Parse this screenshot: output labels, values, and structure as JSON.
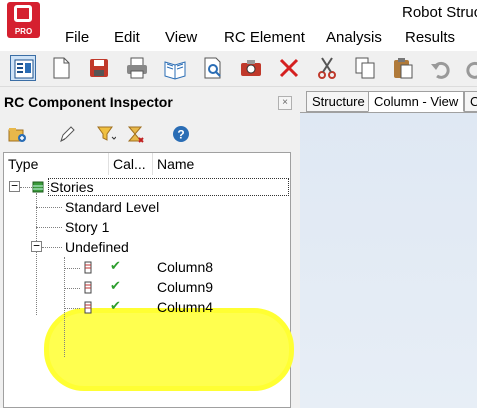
{
  "app": {
    "title": "Robot Struc",
    "logo_text": "PRO",
    "brand_color": "#d5202f"
  },
  "menu": [
    "File",
    "Edit",
    "View",
    "RC Element",
    "Analysis",
    "Results"
  ],
  "toolbar": {
    "icons": [
      "inspector-icon",
      "new-icon",
      "save-icon",
      "print-icon",
      "open-book-icon",
      "print-preview-icon",
      "camera-icon",
      "delete-icon",
      "cut-icon",
      "copy-icon",
      "paste-icon",
      "undo-icon",
      "redo-icon"
    ]
  },
  "panel": {
    "title": "RC Component Inspector",
    "close_glyph": "×",
    "toolbar_icons": [
      "add-group-icon",
      "edit-icon",
      "filter-icon",
      "calculate-icon",
      "help-icon"
    ],
    "columns": [
      "Type",
      "Cal...",
      "Name"
    ]
  },
  "tree": {
    "root": {
      "label": "Stories",
      "expander": "−"
    },
    "levels": [
      "Standard Level",
      "Story 1"
    ],
    "group": {
      "label": "Undefined",
      "expander": "−"
    },
    "elements": [
      {
        "name": "Column8",
        "status": "✔"
      },
      {
        "name": "Column9",
        "status": "✔"
      },
      {
        "name": "Column4",
        "status": "✔"
      }
    ],
    "highlight_color": "#ffff33"
  },
  "tabs": [
    "Structure",
    "Column - View",
    "C"
  ]
}
